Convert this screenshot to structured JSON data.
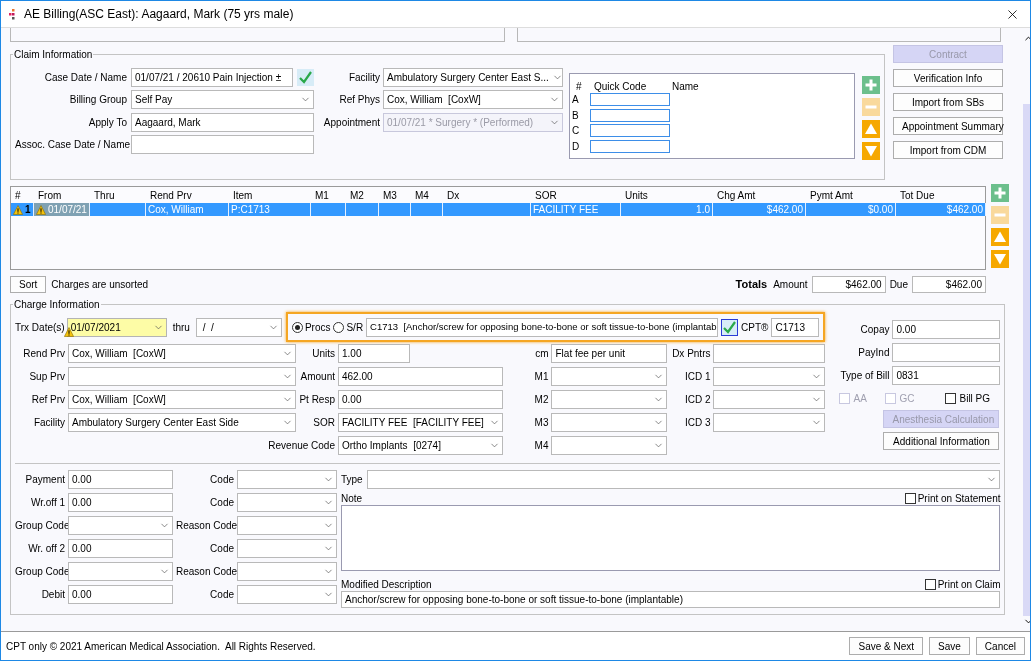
{
  "window": {
    "title": "AE Billing(ASC East): Aagaard, Mark (75 yrs male)"
  },
  "claim_information": {
    "legend": "Claim Information",
    "left_fields": [
      {
        "label": "Case Date / Name",
        "kind": "text_check",
        "value": "01/07/21 / 20610 Pain Injection ±"
      },
      {
        "label": "Billing Group",
        "kind": "select",
        "value": "Self Pay"
      },
      {
        "label": "Apply To",
        "kind": "text",
        "value": "Aagaard, Mark"
      },
      {
        "label": "Assoc. Case Date / Name",
        "kind": "text"
      }
    ],
    "right_fields": [
      {
        "label": "Facility",
        "kind": "select",
        "value": "Ambulatory Surgery Center East S...",
        "disabled": false
      },
      {
        "label": "Ref Phys",
        "kind": "select",
        "value": "Cox, William  [CoxW]",
        "disabled": false
      },
      {
        "label": "Appointment",
        "kind": "select",
        "value": "01/07/21 * Surgery * (Performed)",
        "disabled": true
      }
    ],
    "quick_codes": {
      "columns": [
        "#",
        "Quick Code",
        "Name"
      ],
      "rows": [
        "A",
        "B",
        "C",
        "D"
      ]
    },
    "tools": [
      {
        "kind": "add",
        "disabled": false
      },
      {
        "kind": "remove",
        "disabled": true
      },
      {
        "kind": "up",
        "disabled": false
      },
      {
        "kind": "down",
        "disabled": false
      }
    ]
  },
  "side_buttons": [
    {
      "label": "Contract",
      "disabled": true
    },
    {
      "label": "Verification Info",
      "disabled": false
    },
    {
      "label": "Import from SBs",
      "disabled": false
    },
    {
      "label": "Appointment Summary",
      "disabled": false
    },
    {
      "label": "Import from CDM",
      "disabled": false
    }
  ],
  "charges": {
    "columns": [
      "#",
      "From",
      "Thru",
      "Rend Prv",
      "Item",
      "M1",
      "M2",
      "M3",
      "M4",
      "Dx",
      "SOR",
      "Units",
      "Chg Amt",
      "Pymt Amt",
      "Tot Due"
    ],
    "rows": [
      {
        "selected": true,
        "warning": true,
        "cells": [
          "1",
          "01/07/21",
          null,
          "Cox, William",
          "P:C1713",
          null,
          null,
          null,
          null,
          null,
          "FACILITY FEE",
          "1.0",
          "$462.00",
          "$0.00",
          "$462.00"
        ]
      }
    ],
    "tools": [
      {
        "kind": "add",
        "disabled": false
      },
      {
        "kind": "remove",
        "disabled": true
      },
      {
        "kind": "up",
        "disabled": false
      },
      {
        "kind": "down",
        "disabled": false
      }
    ],
    "sort_button": "Sort",
    "sort_status": "Charges are unsorted",
    "totals": {
      "heading": "Totals",
      "amount_label": "Amount",
      "amount": "$462.00",
      "due_label": "Due",
      "due": "$462.00"
    }
  },
  "charge_information": {
    "legend": "Charge Information",
    "trx_date": {
      "label": "Trx Date(s)",
      "kind": "select",
      "value": "01/07/2021",
      "warning": true
    },
    "thru": {
      "label": "thru",
      "kind": "select",
      "value": " /  /"
    },
    "transaction_type": [
      {
        "label": "Procs",
        "selected": true
      },
      {
        "label": "S/R",
        "selected": false
      }
    ],
    "procedure": {
      "kind": "select",
      "value": "C1713  [Anchor/screw for opposing bone-to-bone or soft tissue-to-bone (implantab"
    },
    "cpt": {
      "label": "CPT®",
      "kind": "text",
      "value": "C1713"
    },
    "left_column": [
      {
        "label": "Rend Prv",
        "kind": "select",
        "value": "Cox, William  [CoxW]"
      },
      {
        "label": "Sup Prv",
        "kind": "select"
      },
      {
        "label": "Ref Prv",
        "kind": "select",
        "value": "Cox, William  [CoxW]"
      },
      {
        "label": "Facility",
        "kind": "select",
        "value": "Ambulatory Surgery Center East Side"
      }
    ],
    "middle_column": [
      {
        "label": "Units",
        "kind": "short",
        "value": "1.00"
      },
      {
        "label": "Amount",
        "kind": "text",
        "value": "462.00"
      },
      {
        "label": "Pt Resp",
        "kind": "text",
        "value": "0.00"
      },
      {
        "label": "SOR",
        "kind": "select",
        "value": "FACILITY FEE  [FACILITY FEE]"
      },
      {
        "label": "Revenue Code",
        "kind": "select",
        "value": "Ortho Implants  [0274]"
      }
    ],
    "modifier_column": [
      {
        "label": "cm",
        "kind": "text",
        "value": "Flat fee per unit"
      },
      {
        "label": "M1",
        "kind": "select"
      },
      {
        "label": "M2",
        "kind": "select"
      },
      {
        "label": "M3",
        "kind": "select"
      },
      {
        "label": "M4",
        "kind": "select"
      }
    ],
    "diagnosis_column": [
      {
        "label": "Dx Pntrs",
        "kind": "text"
      },
      {
        "label": "ICD 1",
        "kind": "select"
      },
      {
        "label": "ICD 2",
        "kind": "select"
      },
      {
        "label": "ICD 3",
        "kind": "select"
      }
    ],
    "right_column": [
      {
        "label": "Copay",
        "kind": "text",
        "value": "0.00"
      },
      {
        "label": "PayInd",
        "kind": "text"
      },
      {
        "label": "Type of Bill",
        "kind": "text",
        "value": "0831"
      }
    ],
    "checkboxes": [
      {
        "label": "AA",
        "checked": false,
        "disabled": true
      },
      {
        "label": "GC",
        "checked": false,
        "disabled": true
      },
      {
        "label": "Bill PG",
        "checked": false,
        "disabled": false
      }
    ],
    "buttons": [
      {
        "label": "Anesthesia Calculation",
        "disabled": true
      },
      {
        "label": "Additional Information",
        "disabled": false
      }
    ],
    "adjustments": [
      {
        "left": {
          "label": "Payment",
          "kind": "text",
          "value": "0.00"
        },
        "right": {
          "label": "Code",
          "kind": "select"
        }
      },
      {
        "left": {
          "label": "Wr.off 1",
          "kind": "text",
          "value": "0.00"
        },
        "right": {
          "label": "Code",
          "kind": "select"
        }
      },
      {
        "left": {
          "label": "Group Code",
          "kind": "select"
        },
        "right": {
          "label": "Reason Code",
          "kind": "select"
        }
      },
      {
        "left": {
          "label": "Wr. off 2",
          "kind": "text",
          "value": "0.00"
        },
        "right": {
          "label": "Code",
          "kind": "select"
        }
      },
      {
        "left": {
          "label": "Group Code",
          "kind": "select"
        },
        "right": {
          "label": "Reason Code",
          "kind": "select"
        }
      },
      {
        "left": {
          "label": "Debit",
          "kind": "text",
          "value": "0.00"
        },
        "right": {
          "label": "Code",
          "kind": "select"
        }
      }
    ],
    "type": {
      "label": "Type",
      "kind": "select"
    },
    "note": {
      "label": "Note",
      "print_label": "Print on Statement",
      "print_checked": false
    },
    "modified_description": {
      "label": "Modified Description",
      "print_label": "Print on Claim",
      "print_checked": false,
      "value": "Anchor/screw for opposing bone-to-bone or soft tissue-to-bone (implantable)"
    }
  },
  "footer": {
    "notice": "CPT only © 2021 American Medical Association.  All Rights Reserved.",
    "buttons": [
      "Save & Next",
      "Save",
      "Cancel"
    ]
  }
}
